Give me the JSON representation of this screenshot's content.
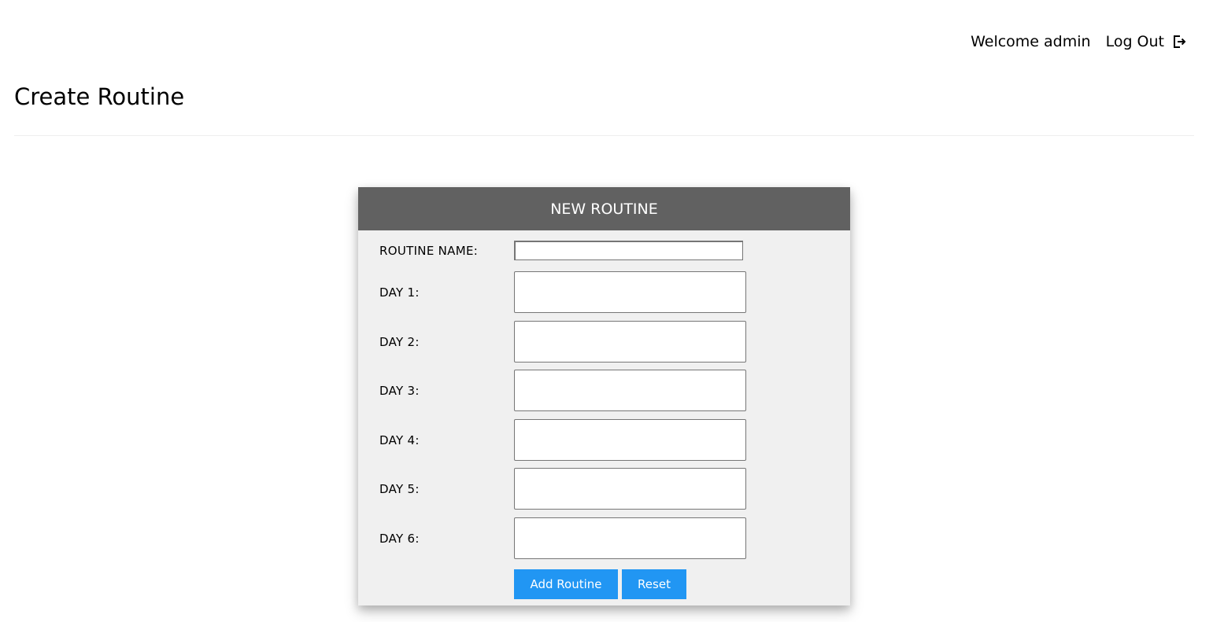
{
  "header": {
    "welcome_text": "Welcome admin",
    "logout_label": "Log Out",
    "logout_icon": "logout-icon"
  },
  "page": {
    "title": "Create Routine"
  },
  "form": {
    "title": "NEW ROUTINE",
    "routine_name_label": "ROUTINE NAME:",
    "routine_name_value": "",
    "days": [
      {
        "label": "DAY 1:",
        "value": ""
      },
      {
        "label": "DAY 2:",
        "value": ""
      },
      {
        "label": "DAY 3:",
        "value": ""
      },
      {
        "label": "DAY 4:",
        "value": ""
      },
      {
        "label": "DAY 5:",
        "value": ""
      },
      {
        "label": "DAY 6:",
        "value": ""
      }
    ],
    "add_button_label": "Add Routine",
    "reset_button_label": "Reset"
  },
  "colors": {
    "header_bg": "#616161",
    "card_bg": "#f0f0f0",
    "button_bg": "#2196f3"
  }
}
